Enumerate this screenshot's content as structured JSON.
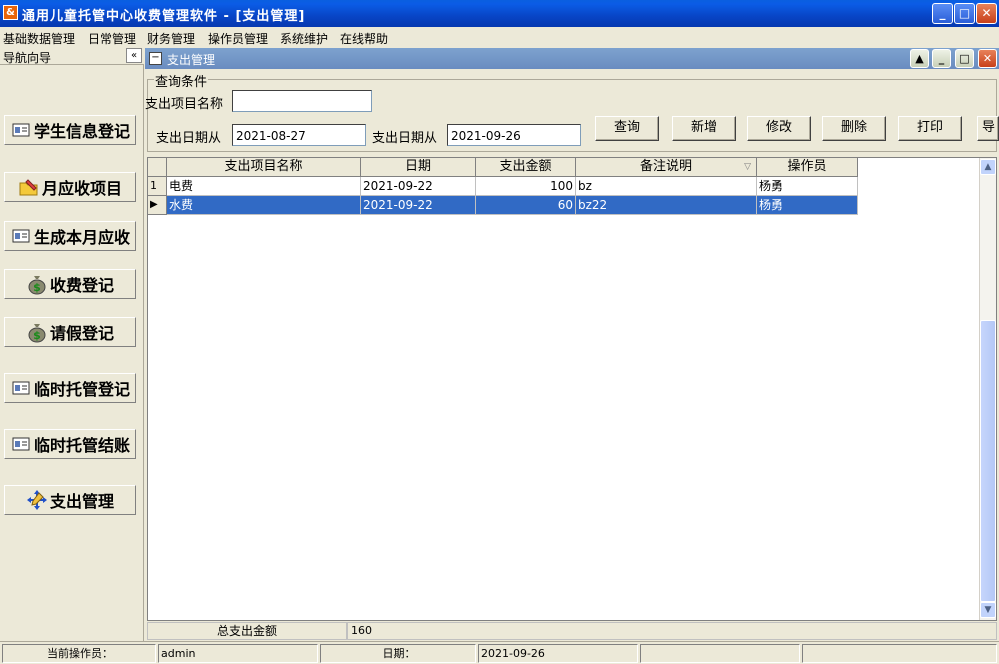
{
  "window": {
    "title": "通用儿童托管中心收费管理软件 - [支出管理]",
    "app_icon_glyph": "&",
    "minimize_glyph": "_",
    "maximize_glyph": "□",
    "close_glyph": "✕"
  },
  "menu": [
    "基础数据管理",
    "日常管理",
    "财务管理",
    "操作员管理",
    "系统维护",
    "在线帮助"
  ],
  "nav": {
    "title": "导航向导",
    "collapse_glyph": "«",
    "items": [
      {
        "label": "学生信息登记",
        "icon": "student-card-icon"
      },
      {
        "label": "月应收项目",
        "icon": "folder-pencil-icon"
      },
      {
        "label": "生成本月应收",
        "icon": "student-card-icon"
      },
      {
        "label": "收费登记",
        "icon": "money-bag-icon"
      },
      {
        "label": "请假登记",
        "icon": "money-bag-icon"
      },
      {
        "label": "临时托管登记",
        "icon": "student-card-icon"
      },
      {
        "label": "临时托管结账",
        "icon": "student-card-icon"
      },
      {
        "label": "支出管理",
        "icon": "pencil-arrows-icon"
      }
    ]
  },
  "child": {
    "title": "支出管理",
    "icon_glyph": "−",
    "up_glyph": "▲",
    "min_glyph": "_",
    "max_glyph": "□",
    "close_glyph": "✕"
  },
  "query": {
    "legend": "查询条件",
    "item_name_label": "支出项目名称",
    "item_name_value": "",
    "date_from_label": "支出日期从",
    "date_from_value": "2021-08-27",
    "date_to_label": "支出日期从",
    "date_to_value": "2021-09-26"
  },
  "buttons": {
    "query": "查询",
    "add": "新增",
    "edit": "修改",
    "delete": "删除",
    "print": "打印",
    "export": "导"
  },
  "table": {
    "columns": [
      "支出项目名称",
      "日期",
      "支出金额",
      "备注说明",
      "操作员"
    ],
    "sort_glyph": "▽",
    "rows": [
      {
        "indicator": "1",
        "name": "电费",
        "date": "2021-09-22",
        "amount": "100",
        "note": "bz",
        "operator": "杨勇",
        "selected": false
      },
      {
        "indicator": "▶",
        "name": "水费",
        "date": "2021-09-22",
        "amount": "60",
        "note": "bz22",
        "operator": "杨勇",
        "selected": true
      }
    ]
  },
  "scroll": {
    "up_glyph": "▲",
    "down_glyph": "▼"
  },
  "summary": {
    "label": "总支出金额",
    "value": "160"
  },
  "status": {
    "operator_label": "当前操作员：",
    "operator_value": "admin",
    "date_label": "日期：",
    "date_value": "2021-09-26"
  },
  "colors": {
    "selection": "#316ac5",
    "titlebar": "#0845c6"
  }
}
